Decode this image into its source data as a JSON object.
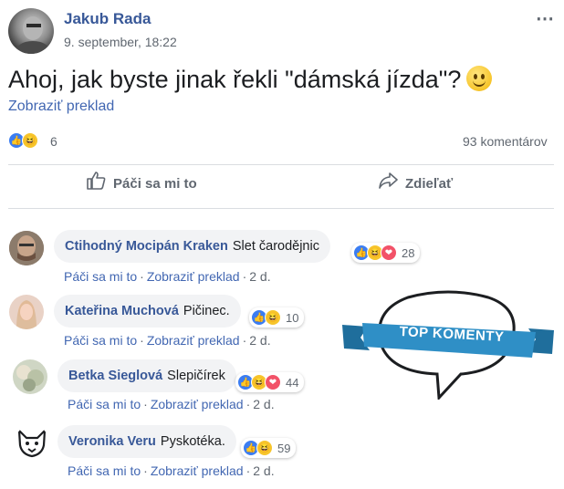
{
  "post": {
    "author": "Jakub Rada",
    "date": "9. september, 18:22",
    "more_icon": "⋯",
    "text": "Ahoj, jak byste jinak řekli \"dámská jízda\"?",
    "translate": "Zobraziť preklad",
    "reaction_count": "6",
    "comment_count": "93 komentárov",
    "like_action": "Páči sa mi to",
    "share_action": "Zdieľať"
  },
  "comments": [
    {
      "name": "Ctihodný Mocipán Kraken",
      "text": "Slet čarodějnic",
      "reactions": "28",
      "like": "Páči sa mi to",
      "translate": "Zobraziť preklad",
      "time": "2 d."
    },
    {
      "name": "Kateřina Muchová",
      "text": "Pičinec.",
      "reactions": "10",
      "like": "Páči sa mi to",
      "translate": "Zobraziť preklad",
      "time": "2 d."
    },
    {
      "name": "Betka Sieglová",
      "text": "Slepičírek",
      "reactions": "44",
      "like": "Páči sa mi to",
      "translate": "Zobraziť preklad",
      "time": "2 d."
    },
    {
      "name": "Veronika Veru",
      "text": "Pyskotéka.",
      "reactions": "59",
      "like": "Páči sa mi to",
      "translate": "Zobraziť preklad",
      "time": "2 d."
    }
  ],
  "badge": {
    "text": "TOP KOMENTY"
  },
  "colors": {
    "link": "#385898",
    "accent": "#4267b2",
    "muted": "#606770",
    "bubble": "#f2f3f5",
    "ribbon": "#2f8fc6"
  }
}
